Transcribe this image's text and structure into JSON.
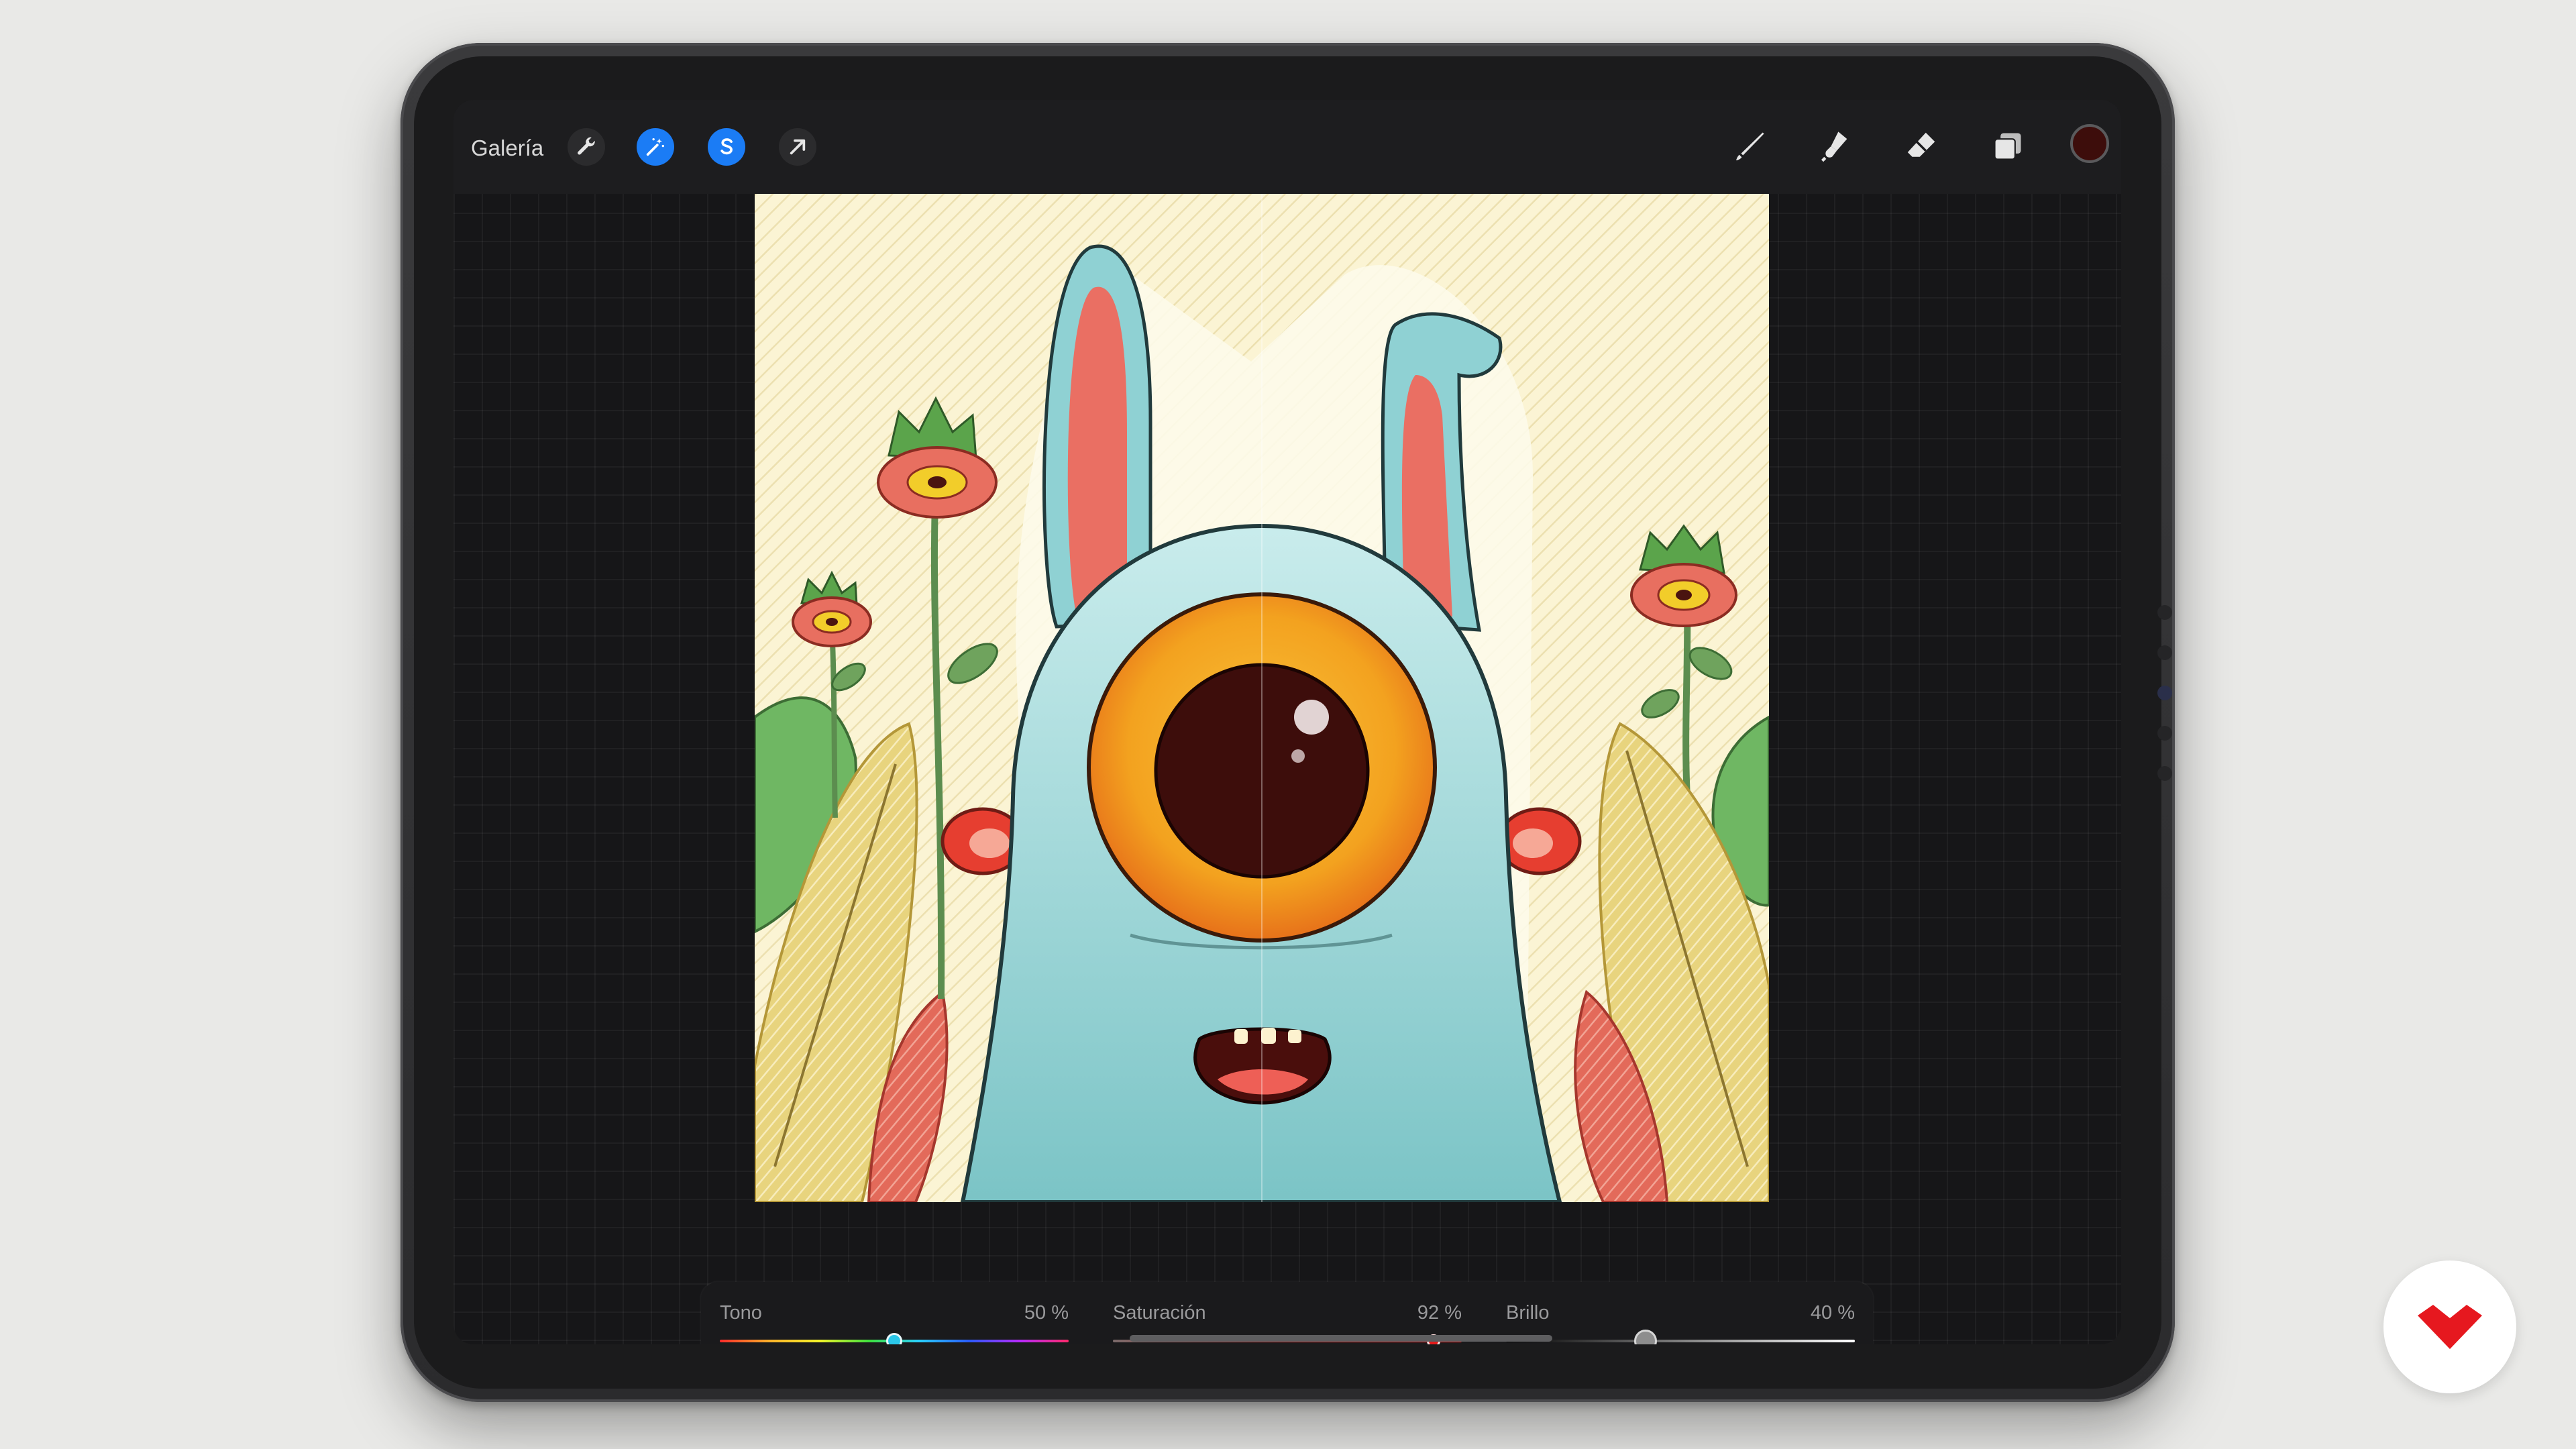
{
  "toolbar": {
    "gallery_label": "Galería",
    "left_tools": [
      {
        "icon": "wrench-icon"
      },
      {
        "icon": "magic-wand-icon",
        "active": true
      },
      {
        "icon": "selection-s-icon",
        "active": true
      },
      {
        "icon": "arrow-transform-icon"
      }
    ],
    "right_tools": [
      {
        "icon": "brush-icon"
      },
      {
        "icon": "smudge-icon"
      },
      {
        "icon": "eraser-icon"
      },
      {
        "icon": "layers-icon"
      }
    ],
    "current_color": "#3d0d0b"
  },
  "adjustments": {
    "hue": {
      "label": "Tono",
      "value_text": "50 %",
      "value": 0.5
    },
    "saturation": {
      "label": "Saturación",
      "value_text": "92 %",
      "value": 0.92
    },
    "brightness": {
      "label": "Brillo",
      "value_text": "40 %",
      "value": 0.4
    }
  },
  "colors": {
    "active_tool": "#1b7cf5",
    "monster_body": "#8fcfcf",
    "eye_iris": "#f29a1b",
    "canvas_background": "#fbf6dc"
  },
  "brand_logo_icon": "domestika-heart-icon"
}
